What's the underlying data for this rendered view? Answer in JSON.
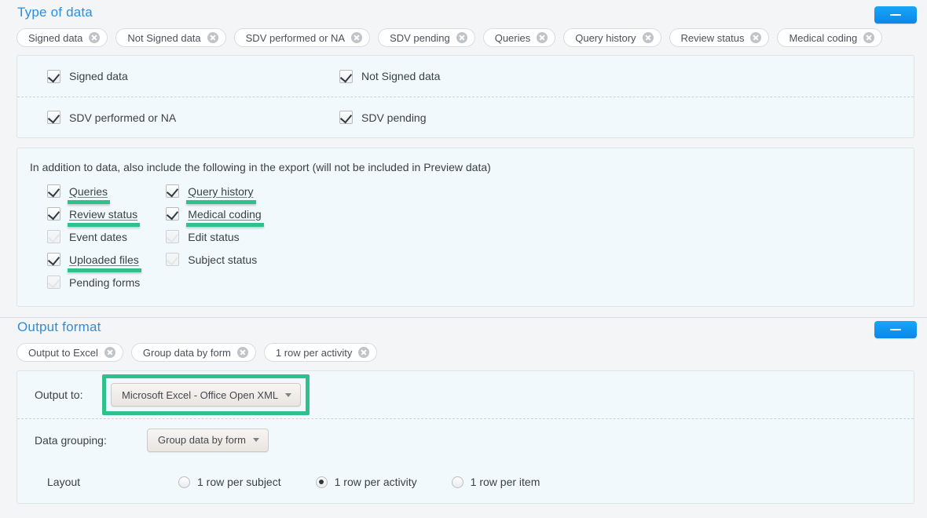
{
  "type_of_data": {
    "title": "Type of data",
    "collapse_label": "–",
    "chips": [
      {
        "label": "Signed data"
      },
      {
        "label": "Not Signed data"
      },
      {
        "label": "SDV performed or NA"
      },
      {
        "label": "SDV pending"
      },
      {
        "label": "Queries"
      },
      {
        "label": "Query history"
      },
      {
        "label": "Review status"
      },
      {
        "label": "Medical coding"
      }
    ],
    "data_checks": [
      {
        "label": "Signed data",
        "checked": true
      },
      {
        "label": "Not Signed data",
        "checked": true
      },
      {
        "label": "SDV performed or NA",
        "checked": true
      },
      {
        "label": "SDV pending",
        "checked": true
      }
    ],
    "addition_note": "In addition to data, also include the following in the export (will not be included in Preview data)",
    "addition_left": [
      {
        "label": "Queries",
        "checked": true,
        "highlight": true
      },
      {
        "label": "Review status",
        "checked": true,
        "highlight": true
      },
      {
        "label": "Event dates",
        "checked": false,
        "highlight": false
      },
      {
        "label": "Uploaded files",
        "checked": true,
        "highlight": true
      },
      {
        "label": "Pending forms",
        "checked": false,
        "highlight": false
      }
    ],
    "addition_right": [
      {
        "label": "Query history",
        "checked": true,
        "highlight": true
      },
      {
        "label": "Medical coding",
        "checked": true,
        "highlight": true
      },
      {
        "label": "Edit status",
        "checked": false,
        "highlight": false
      },
      {
        "label": "Subject status",
        "checked": false,
        "highlight": false
      }
    ]
  },
  "output_format": {
    "title": "Output format",
    "collapse_label": "–",
    "chips": [
      {
        "label": "Output to Excel"
      },
      {
        "label": "Group data by form"
      },
      {
        "label": "1 row per activity"
      }
    ],
    "output_to_label": "Output to:",
    "output_to_value": "Microsoft Excel - Office Open XML",
    "data_grouping_label": "Data grouping:",
    "data_grouping_value": "Group data by form",
    "layout_label": "Layout",
    "layout_options": [
      {
        "label": "1 row per subject",
        "selected": false
      },
      {
        "label": "1 row per activity",
        "selected": true
      },
      {
        "label": "1 row per item",
        "selected": false
      }
    ]
  },
  "colors": {
    "accent_blue": "#2a8fe0",
    "button_blue": "#0b87ea",
    "highlight_green": "#2fc08c",
    "panel_bg": "#f2f9fd",
    "page_bg": "#f4f5f6"
  }
}
